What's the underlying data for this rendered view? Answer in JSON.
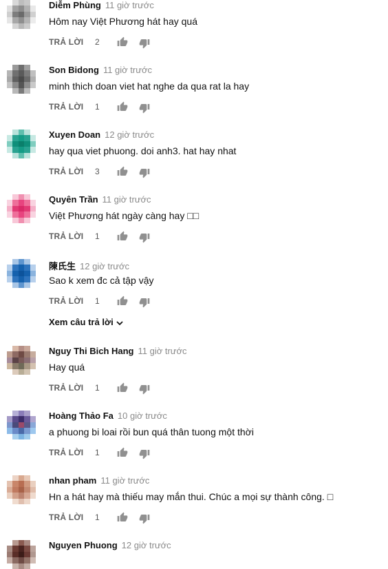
{
  "reply_label": "TRẢ LỜI",
  "view_replies_label": "Xem câu trả lời",
  "comments": [
    {
      "author": "Diễm Phùng",
      "time": "11 giờ trước",
      "text": "Hôm nay Việt Phương hát hay quá",
      "likes": "2",
      "avatar_colors": [
        "#ffffff",
        "#d8d8d8",
        "#bdbdbd",
        "#c8c8c8",
        "#ffffff",
        "#e0e0e0",
        "#a0a0a0",
        "#8c8c8c",
        "#b0b0b0",
        "#e8e8e8",
        "#cfcfcf",
        "#7d7d7d",
        "#6a6a6a",
        "#9a9a9a",
        "#d0d0d0",
        "#e6e6e6",
        "#a8a8a8",
        "#8f8f8f",
        "#b4b4b4",
        "#ececec",
        "#ffffff",
        "#d4d4d4",
        "#b8b8b8",
        "#cccccc",
        "#ffffff"
      ]
    },
    {
      "author": "Son Bidong",
      "time": "11 giờ trước",
      "text": "minh thich doan viet hat  nghe da qua  rat la hay",
      "likes": "1",
      "avatar_colors": [
        "#ffffff",
        "#9a9a9a",
        "#6e6e6e",
        "#a0a0a0",
        "#ffffff",
        "#b5b5b5",
        "#707070",
        "#5a5a5a",
        "#7c7c7c",
        "#c0c0c0",
        "#a8a8a8",
        "#606060",
        "#4a4a4a",
        "#6a6a6a",
        "#b0b0b0",
        "#c4c4c4",
        "#8a8a8a",
        "#555555",
        "#8e8e8e",
        "#cacaca",
        "#ffffff",
        "#b8b8b8",
        "#7a7a7a",
        "#bcbcbc",
        "#ffffff"
      ]
    },
    {
      "author": "Xuyen Doan",
      "time": "12 giờ trước",
      "text": "hay qua viet phuong.  doi anh3. hat hay nhat",
      "likes": "3",
      "avatar_colors": [
        "#ffffff",
        "#b9e2db",
        "#5fbfae",
        "#b9e2db",
        "#ffffff",
        "#c7e9e3",
        "#2aa391",
        "#149c86",
        "#2aa391",
        "#c7e9e3",
        "#7fcdbf",
        "#0f8f7a",
        "#0b7f6b",
        "#0f8f7a",
        "#7fcdbf",
        "#c7e9e3",
        "#2aa391",
        "#149c86",
        "#2aa391",
        "#c7e9e3",
        "#ffffff",
        "#b9e2db",
        "#5fbfae",
        "#b9e2db",
        "#ffffff"
      ]
    },
    {
      "author": "Quyên Trần",
      "time": "11 giờ trước",
      "text": "Việt Phương hát ngày càng hay □□",
      "likes": "1",
      "avatar_colors": [
        "#ffffff",
        "#f8c8d8",
        "#f090b0",
        "#f8c8d8",
        "#ffffff",
        "#f9d3e0",
        "#ee6f9a",
        "#e8447f",
        "#ee6f9a",
        "#f9d3e0",
        "#f5b0c8",
        "#e23a75",
        "#d92a68",
        "#e23a75",
        "#f5b0c8",
        "#f9d3e0",
        "#ee6f9a",
        "#e8447f",
        "#ee6f9a",
        "#f9d3e0",
        "#ffffff",
        "#f8c8d8",
        "#f090b0",
        "#f8c8d8",
        "#ffffff"
      ]
    },
    {
      "author": "陳氏生",
      "time": "12 giờ trước",
      "text": "Sao k xem đc cả tập vậy",
      "likes": "1",
      "avatar_colors": [
        "#ffffff",
        "#a9c6e6",
        "#5e95cf",
        "#a9c6e6",
        "#ffffff",
        "#b7d0ec",
        "#2f74bd",
        "#1561ad",
        "#2f74bd",
        "#b7d0ec",
        "#8ab3de",
        "#1561ad",
        "#0d539b",
        "#1561ad",
        "#8ab3de",
        "#b7d0ec",
        "#2f74bd",
        "#1561ad",
        "#2f74bd",
        "#b7d0ec",
        "#ffffff",
        "#a9c6e6",
        "#5e95cf",
        "#a9c6e6",
        "#ffffff"
      ]
    },
    {
      "author": "Nguy Thi Bich Hang",
      "time": "11 giờ trước",
      "text": "Hay quá",
      "likes": "1",
      "avatar_colors": [
        "#ffffff",
        "#d9b9a8",
        "#b58f86",
        "#c9a89a",
        "#ffffff",
        "#bd9c8e",
        "#8e6a63",
        "#6f4a44",
        "#9a7a6f",
        "#c7ad9e",
        "#a88c9a",
        "#5b4246",
        "#7a5a58",
        "#8a6d73",
        "#b9a0a8",
        "#cdb8a0",
        "#8a7c6a",
        "#6f6a58",
        "#a89884",
        "#d4c2b0",
        "#ffffff",
        "#dccbbb",
        "#b8ad96",
        "#d2c4b2",
        "#ffffff"
      ]
    },
    {
      "author": "Hoàng Thảo Fa",
      "time": "10 giờ trước",
      "text": "a phuong bi loai rồi bun quá thân tuong một thời",
      "likes": "1",
      "avatar_colors": [
        "#ffffff",
        "#b6b0d6",
        "#8a7cb8",
        "#a99fc9",
        "#ffffff",
        "#a59bc8",
        "#5a4a8a",
        "#3c2d6a",
        "#6a5a9a",
        "#b0a6cf",
        "#7d96cc",
        "#4a4a7a",
        "#9a4a6a",
        "#5a5a8a",
        "#8aa8d8",
        "#8dbbe8",
        "#6a8ac8",
        "#4a6aa8",
        "#7a9ad0",
        "#9ec8ee",
        "#ffffff",
        "#a8d0ee",
        "#7cb4e2",
        "#a0ccec",
        "#ffffff"
      ]
    },
    {
      "author": "nhan pham",
      "time": "11 giờ trước",
      "text": "Hn a hát hay mà thiếu may mắn thui. Chúc a mọi sự thành công. □",
      "likes": "1",
      "avatar_colors": [
        "#ffffff",
        "#ecd3c5",
        "#d8a88f",
        "#e7c8b6",
        "#ffffff",
        "#e4c2b0",
        "#c9866a",
        "#b86e52",
        "#d09a80",
        "#ead0c0",
        "#d9ab95",
        "#c07a60",
        "#a86248",
        "#c48a72",
        "#e0bca9",
        "#ead0c0",
        "#d2a08a",
        "#bd8470",
        "#d6a894",
        "#efdacd",
        "#ffffff",
        "#f0dccf",
        "#e0bfae",
        "#eed8ca",
        "#ffffff"
      ]
    },
    {
      "author": "Nguyen Phuong",
      "time": "12 giờ trước",
      "text": "",
      "likes": "",
      "avatar_colors": [
        "#ffffff",
        "#b89a90",
        "#8a5a50",
        "#a88880",
        "#ffffff",
        "#a88c84",
        "#6a3a32",
        "#4a2420",
        "#7a4a42",
        "#bca49c",
        "#9a7a72",
        "#5a2e28",
        "#3c1c18",
        "#6a3a34",
        "#b09890",
        "#c4aca4",
        "#8a6a62",
        "#6e4a44",
        "#927268",
        "#d0bcb4",
        "#ffffff",
        "#c8b4ac",
        "#a88c84",
        "#c4aea6",
        "#ffffff"
      ]
    }
  ]
}
